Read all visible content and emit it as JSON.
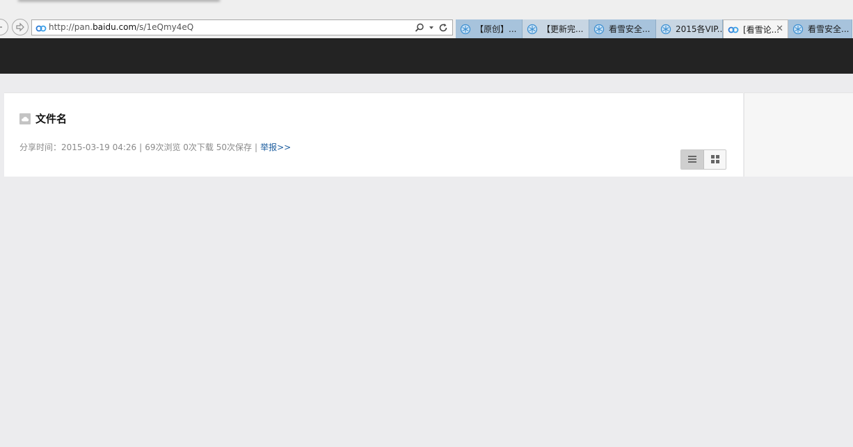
{
  "browser": {
    "address_url_prefix": "http://pan.",
    "address_url_domain": "baidu.com",
    "address_url_path": "/s/1eQmy4eQ",
    "tabs": [
      {
        "label": "【原创】...",
        "icon": "kanxue-icon",
        "width": 96
      },
      {
        "label": "【更新完...",
        "icon": "kanxue-icon",
        "width": 96
      },
      {
        "label": "看雪安全...",
        "icon": "kanxue-icon",
        "width": 96
      },
      {
        "label": "2015各VIP...",
        "icon": "kanxue-icon",
        "width": 96
      },
      {
        "label": "[看雪论...",
        "icon": "baidu-pan-icon",
        "width": 94
      },
      {
        "label": "看雪安全...",
        "icon": "kanxue-icon",
        "width": 92
      }
    ],
    "active_tab_close": "✕"
  },
  "file": {
    "title": "文件名",
    "share_time_label": "分享时间：",
    "share_time": "2015-03-19 04:26",
    "stats": "69次浏览 0次下载 50次保存",
    "report": "举报>>"
  },
  "colors": {
    "topbar": "#232323",
    "link": "#1b5c9e",
    "tab_bg": "#a7c3dc"
  }
}
